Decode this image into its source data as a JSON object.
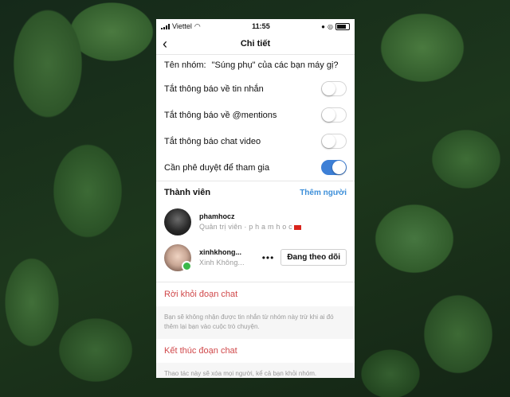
{
  "status_bar": {
    "carrier": "Viettel",
    "time": "11:55"
  },
  "header": {
    "back_icon": "chevron-left-icon",
    "title": "Chi tiết"
  },
  "group": {
    "name_label": "Tên nhóm:",
    "name_value": "\"Súng phụ\" của các bạn máy gị?"
  },
  "settings": [
    {
      "label": "Tắt thông báo về tin nhắn",
      "on": false
    },
    {
      "label": "Tắt thông báo về @mentions",
      "on": false
    },
    {
      "label": "Tắt thông báo chat video",
      "on": false
    },
    {
      "label": "Cần phê duyệt để tham gia",
      "on": true
    }
  ],
  "members_section": {
    "title": "Thành viên",
    "add_label": "Thêm người"
  },
  "members": [
    {
      "username": "phamhocz",
      "subtitle": "Quản trị viên · p h a m h o c"
    },
    {
      "username": "xinhkhong...",
      "subtitle": "Xinh Không...",
      "more": "•••",
      "follow_label": "Đang theo dõi"
    }
  ],
  "leave": {
    "label": "Rời khỏi đoạn chat",
    "note": "Bạn sẽ không nhận được tin nhắn từ nhóm này trừ khi ai đó thêm lại bạn vào cuộc trò chuyện."
  },
  "end": {
    "label": "Kết thúc đoạn chat",
    "note": "Thao tác này sẽ xóa mọi người, kể cả bạn khỏi nhóm."
  },
  "colors": {
    "accent": "#3d7fd6",
    "link": "#3d8fd9",
    "danger": "#d0484a"
  }
}
